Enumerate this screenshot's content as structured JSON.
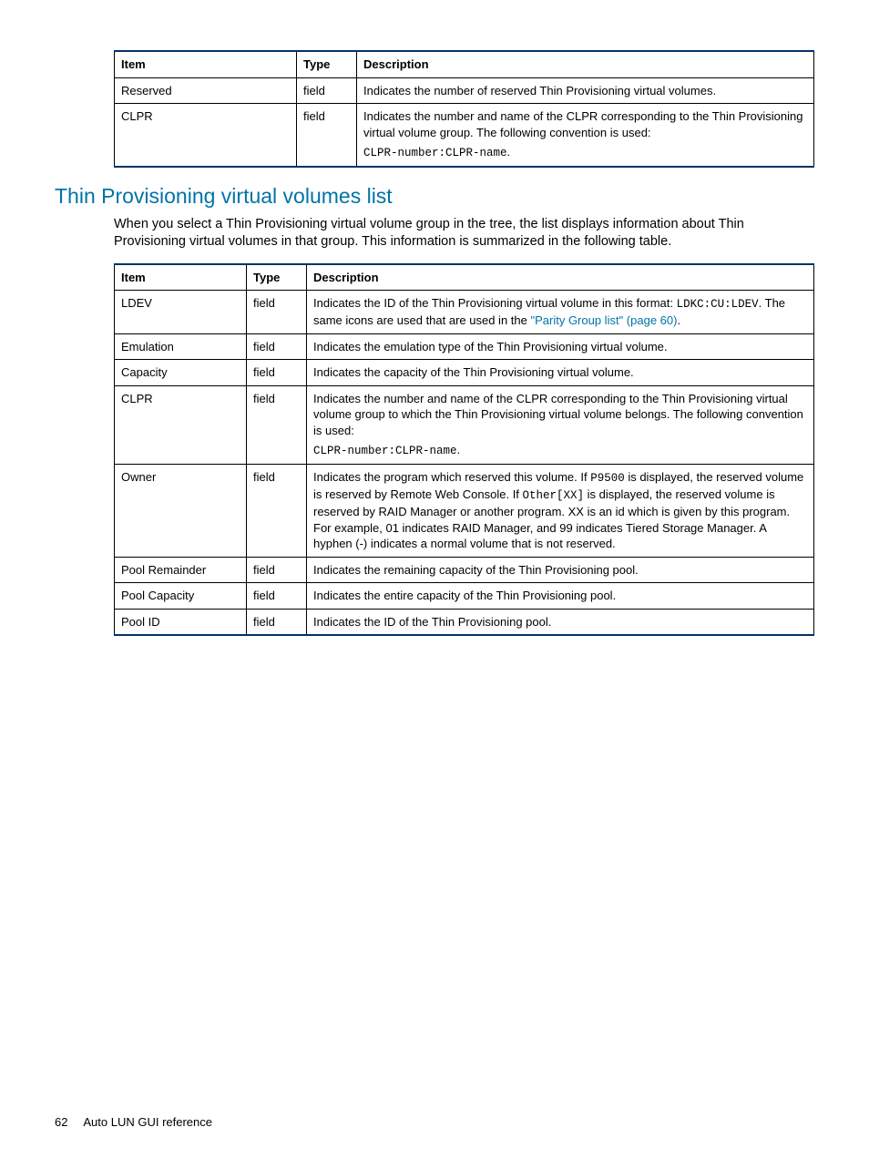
{
  "table1": {
    "headers": {
      "item": "Item",
      "type": "Type",
      "desc": "Description"
    },
    "rows": [
      {
        "item": "Reserved",
        "type": "field",
        "desc_plain": "Indicates the number of reserved Thin Provisioning virtual volumes."
      },
      {
        "item": "CLPR",
        "type": "field",
        "desc_line1": "Indicates the number and name of the CLPR corresponding to the Thin Provisioning virtual volume group. The following convention is used:",
        "desc_code": "CLPR-number:CLPR-name",
        "desc_period": "."
      }
    ]
  },
  "section": {
    "heading": "Thin Provisioning virtual volumes list",
    "para": "When you select a Thin Provisioning virtual volume group in the tree, the list displays information about Thin Provisioning virtual volumes in that group. This information is summarized in the following table."
  },
  "table2": {
    "headers": {
      "item": "Item",
      "type": "Type",
      "desc": "Description"
    },
    "rows": {
      "ldev": {
        "item": "LDEV",
        "type": "field",
        "desc_pre": "Indicates the ID of the Thin Provisioning virtual volume in this format: ",
        "desc_code": "LDKC:CU:LDEV",
        "desc_mid": ". The same icons are used that are used in the ",
        "desc_link": "\"Parity Group list\" (page 60)",
        "desc_post": "."
      },
      "emulation": {
        "item": "Emulation",
        "type": "field",
        "desc": "Indicates the emulation type of the Thin Provisioning virtual volume."
      },
      "capacity": {
        "item": "Capacity",
        "type": "field",
        "desc": "Indicates the capacity of the Thin Provisioning virtual volume."
      },
      "clpr": {
        "item": "CLPR",
        "type": "field",
        "desc_line1": "Indicates the number and name of the CLPR corresponding to the Thin Provisioning virtual volume group to which the Thin Provisioning virtual volume belongs. The following convention is used:",
        "desc_code": "CLPR-number:CLPR-name",
        "desc_period": "."
      },
      "owner": {
        "item": "Owner",
        "type": "field",
        "desc_p1": "Indicates the program which reserved this volume. If ",
        "desc_c1": "P9500",
        "desc_p2": " is displayed, the reserved volume is reserved by Remote Web Console. If ",
        "desc_c2": "Other[XX]",
        "desc_p3": " is displayed, the reserved volume is reserved by RAID Manager or another program. XX is an id which is given by this program. For example, 01 indicates RAID Manager, and 99 indicates Tiered Storage Manager. A hyphen (-) indicates a normal volume that is not reserved."
      },
      "pool_remainder": {
        "item": "Pool Remainder",
        "type": "field",
        "desc": "Indicates the remaining capacity of the Thin Provisioning pool."
      },
      "pool_capacity": {
        "item": "Pool Capacity",
        "type": "field",
        "desc": "Indicates the entire capacity of the Thin Provisioning pool."
      },
      "pool_id": {
        "item": "Pool ID",
        "type": "field",
        "desc": "Indicates the ID of the Thin Provisioning pool."
      }
    }
  },
  "footer": {
    "page": "62",
    "title": "Auto LUN GUI reference"
  }
}
